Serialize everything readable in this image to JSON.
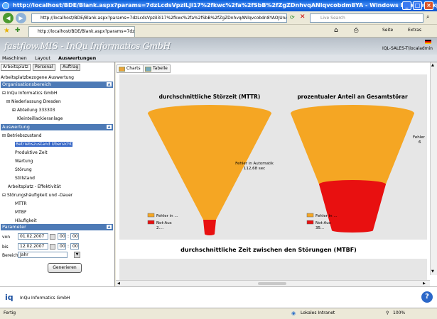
{
  "browser": {
    "window_title": "http://localhost/BDE/Blank.aspx?params=7dzLcdsVpziLJi17%2fkwc%2fa%2fSbB%2fZgZDnhvqANlqvcobdm8YA - Windows Internet Explorer",
    "address": "http://localhost/BDE/Blank.aspx?params=7dzLcdsVpziI3i17%2fkwc%2fa%2fSbB%2fZgZDnhvqANlqvcobdn8YAOJUnAt5cBLJ",
    "search_placeholder": "Live Search",
    "tab_label": "http://localhost/BDE/Blank.aspx?params=7dzLcdsVpzi...",
    "cmd_page": "Seite",
    "cmd_extras": "Extras",
    "status_left": "Fertig",
    "status_zone": "Lokales Intranet",
    "zoom": "100%"
  },
  "app": {
    "brand": "fastflow.MIS - InQu Informatics GmbH",
    "user": "IQL-SALES-T\\localadmin",
    "menu": [
      "Maschinen",
      "Layout",
      "Auswertungen"
    ],
    "footer_company": "InQu Informatics GmbH"
  },
  "left": {
    "tabs": [
      "Arbeitsplatz",
      "Personal",
      "Auftrag"
    ],
    "subtitle": "Arbeitsplatzbezogene Auswertung",
    "org_header": "Organisationsbereich",
    "org_items": [
      "InQu Informatics GmbH",
      "Niederlassung Dresden",
      "Abteilung 333303",
      "Kleinteillackieranlage"
    ],
    "eval_header": "Auswertung",
    "eval_items": [
      "Betriebszustand",
      "Betriebszustand Übersicht",
      "Produktive Zeit",
      "Wartung",
      "Störung",
      "Stillstand",
      "Arbeitsplatz - Effektivität",
      "Störungshäufigkeit und -Dauer",
      "MTTR",
      "MTBF",
      "Häufigkeit"
    ],
    "param_header": "Parameter",
    "von_label": "von",
    "von_date": "01.02.2007",
    "von_h": "00",
    "von_m": "00",
    "bis_label": "bis",
    "bis_date": "12.02.2007",
    "bis_h": "00",
    "bis_m": "00",
    "bereich_label": "Bereich",
    "bereich_value": "Jahr",
    "generate": "Generieren"
  },
  "main": {
    "tabs": [
      "Charts",
      "Tabelle"
    ],
    "chart1_title": "durchschnittliche Störzeit (MTTR)",
    "chart1_label_line1": "Fehler in Automatik",
    "chart1_label_line2": "112,68 sec",
    "chart1_legend1": "Fehler in ...",
    "chart1_legend2_line1": "Not-Aus",
    "chart1_legend2_line2": "2....",
    "chart2_title": "prozentualer Anteil an Gesamtstörar",
    "chart2_label_line1": "Fehler",
    "chart2_label_line2": "6",
    "chart2_legend1": "Fehler in ...",
    "chart2_legend2_line1": "Not-Aus",
    "chart2_legend2_line2": "35...",
    "chart3_title": "durchschnittliche Zeit zwischen den Störungen (MTBF)"
  },
  "colors": {
    "orange": "#f5a623",
    "red": "#e81010",
    "header_blue": "#4d7ab6",
    "selected": "#3163c5"
  },
  "icons": [
    "back-icon",
    "forward-icon",
    "refresh-icon",
    "stop-icon",
    "search-icon",
    "favorites-icon",
    "home-icon",
    "print-icon",
    "help-icon",
    "calendar-icon"
  ]
}
